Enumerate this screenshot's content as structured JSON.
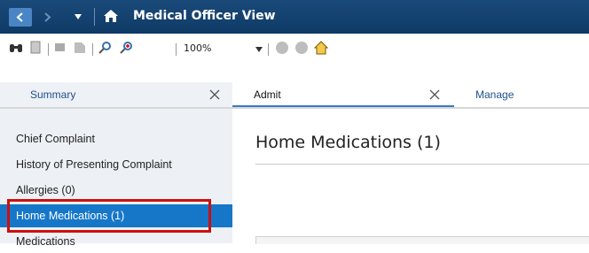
{
  "window": {
    "title": "Medical Officer View"
  },
  "toolbar": {
    "zoom": "100%"
  },
  "tabs": [
    {
      "label": "Summary"
    },
    {
      "label": "Admit"
    },
    {
      "label": "Manage"
    }
  ],
  "nav": {
    "items": [
      {
        "label": "Chief Complaint"
      },
      {
        "label": "History of Presenting Complaint"
      },
      {
        "label": "Allergies (0)"
      },
      {
        "label": "Home Medications (1)"
      },
      {
        "label": "Medications"
      }
    ],
    "selected": "Home Medications (1)"
  },
  "main": {
    "heading": "Home Medications (1)"
  },
  "colors": {
    "titlebar": "#0f3a66",
    "selected": "#1677c9",
    "highlight": "#cc1010",
    "tab_text": "#1f4f8a"
  }
}
